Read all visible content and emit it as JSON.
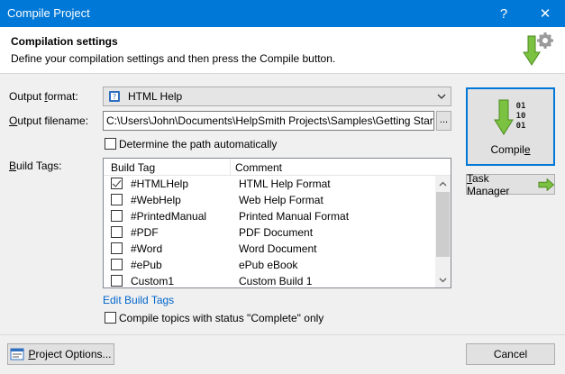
{
  "window": {
    "title": "Compile Project",
    "help_glyph": "?",
    "close_glyph": "✕"
  },
  "header": {
    "title": "Compilation settings",
    "description": "Define your compilation settings and then press the Compile button.",
    "icon": "compile-gear-arrow-icon"
  },
  "output_format": {
    "label_pre": "Output ",
    "label_ul": "f",
    "label_post": "ormat:",
    "value": "HTML Help",
    "icon": "html-help-icon"
  },
  "output_filename": {
    "label_ul": "O",
    "label_post": "utput filename:",
    "value": "C:\\Users\\John\\Documents\\HelpSmith Projects\\Samples\\Getting Started\\Gett",
    "browse_label": "..."
  },
  "auto_path": {
    "label": "Determine the path automatically",
    "checked": false
  },
  "build_tags": {
    "label_ul": "B",
    "label_post": "uild Tags:",
    "columns": [
      "Build Tag",
      "Comment"
    ],
    "rows": [
      {
        "tag": "#HTMLHelp",
        "comment": "HTML Help Format",
        "checked": true
      },
      {
        "tag": "#WebHelp",
        "comment": "Web Help Format",
        "checked": false
      },
      {
        "tag": "#PrintedManual",
        "comment": "Printed Manual Format",
        "checked": false
      },
      {
        "tag": "#PDF",
        "comment": "PDF Document",
        "checked": false
      },
      {
        "tag": "#Word",
        "comment": "Word Document",
        "checked": false
      },
      {
        "tag": "#ePub",
        "comment": "ePub eBook",
        "checked": false
      },
      {
        "tag": "Custom1",
        "comment": "Custom Build 1",
        "checked": false
      }
    ]
  },
  "edit_build_tags": "Edit Build Tags",
  "compile_status": {
    "label": "Compile topics with status \"Complete\" only",
    "checked": false
  },
  "buttons": {
    "compile_pre": "Compil",
    "compile_ul": "e",
    "taskmgr_ul": "T",
    "taskmgr_post": "ask Manager",
    "projopt_ul": "P",
    "projopt_post": "roject Options...",
    "cancel": "Cancel"
  },
  "colors": {
    "accent": "#0078d7",
    "arrow_green": "#7cc242",
    "link": "#0066cc"
  }
}
